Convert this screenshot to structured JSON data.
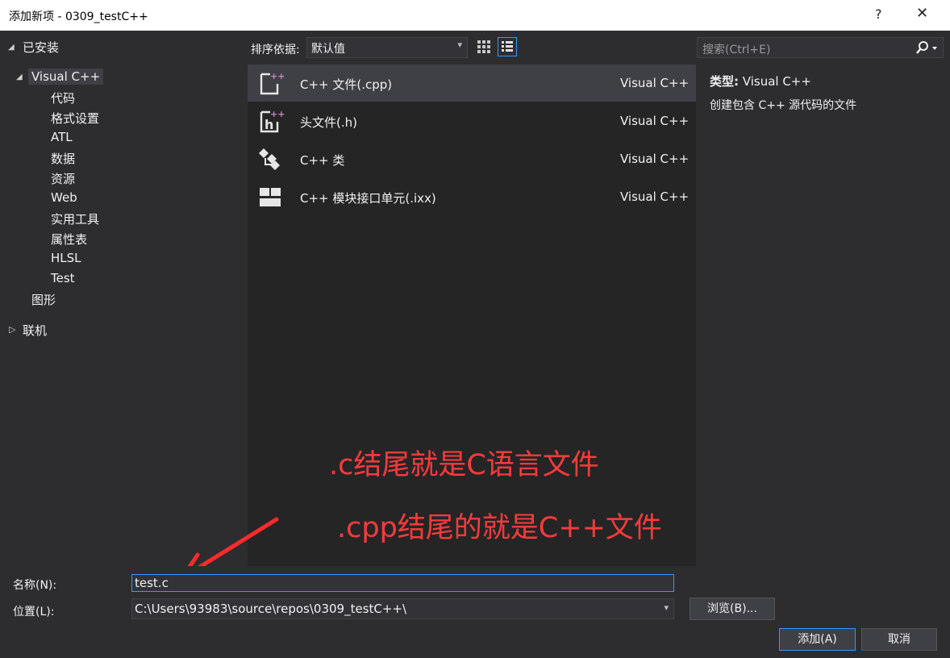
{
  "window": {
    "title": "添加新项 - 0309_testC++",
    "help": "?",
    "close": "✕"
  },
  "tree": {
    "installed": "已安装",
    "visual_cpp": "Visual C++",
    "children": [
      "代码",
      "格式设置",
      "ATL",
      "数据",
      "资源",
      "Web",
      "实用工具",
      "属性表",
      "HLSL",
      "Test"
    ],
    "graphics": "图形",
    "online": "联机"
  },
  "sort": {
    "label": "排序依据:",
    "value": "默认值"
  },
  "search": {
    "placeholder": "搜索(Ctrl+E)"
  },
  "templates": [
    {
      "name": "C++ 文件(.cpp)",
      "lang": "Visual C++",
      "icon": "cpp-file-icon"
    },
    {
      "name": "头文件(.h)",
      "lang": "Visual C++",
      "icon": "header-file-icon"
    },
    {
      "name": "C++ 类",
      "lang": "Visual C++",
      "icon": "class-icon"
    },
    {
      "name": "C++ 模块接口单元(.ixx)",
      "lang": "Visual C++",
      "icon": "module-icon"
    }
  ],
  "details": {
    "type_label": "类型:",
    "type_value": "Visual C++",
    "description": "创建包含 C++ 源代码的文件"
  },
  "annotations": {
    "line1": ".c结尾就是C语言文件",
    "line2": ".cpp结尾的就是C++文件"
  },
  "form": {
    "name_label": "名称(N):",
    "name_value": "test.c",
    "location_label": "位置(L):",
    "location_value": "C:\\Users\\93983\\source\\repos\\0309_testC++\\",
    "browse": "浏览(B)...",
    "add": "添加(A)",
    "cancel": "取消"
  },
  "colors": {
    "accent": "#3399ff",
    "annotation": "#ff3b3b",
    "background": "#2d2d30"
  }
}
